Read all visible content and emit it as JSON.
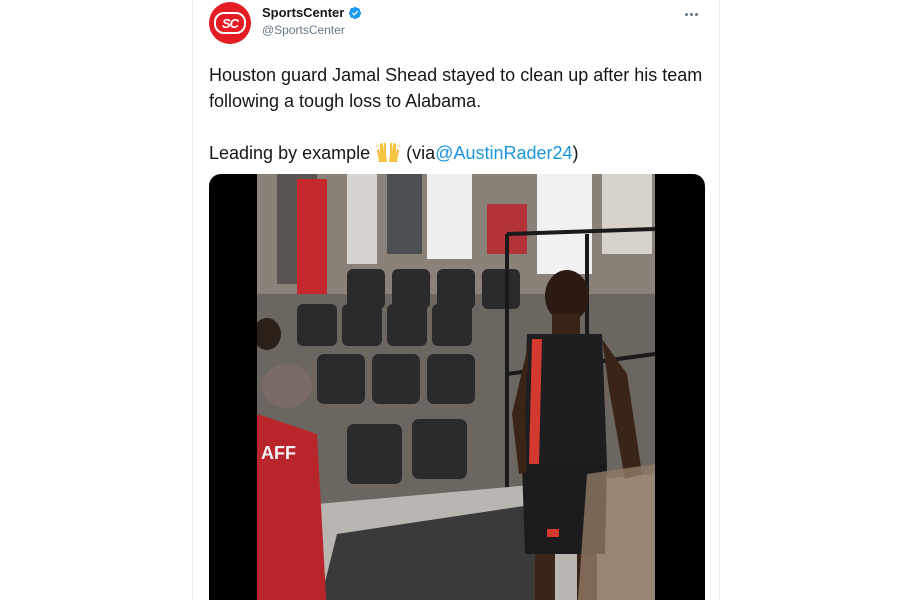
{
  "tweet": {
    "display_name": "SportsCenter",
    "handle": "@SportsCenter",
    "avatar_text": "SC",
    "text_line1": "Houston guard Jamal Shead stayed to clean up after his team following a tough loss to Alabama.",
    "text_line2_prefix": "Leading by example",
    "text_line2_middle": "(via",
    "mention": "@AustinRader24",
    "text_line2_suffix": ")",
    "emoji_icon": "raising-hands-emoji",
    "verified_icon": "verified-badge-icon",
    "more_icon": "more-options-icon"
  },
  "media": {
    "type": "video",
    "jersey_text": "AFF",
    "colors": {
      "brand_red": "#e41c23",
      "link_blue": "#1b95e0",
      "verified_blue": "#1d9bf0"
    }
  }
}
